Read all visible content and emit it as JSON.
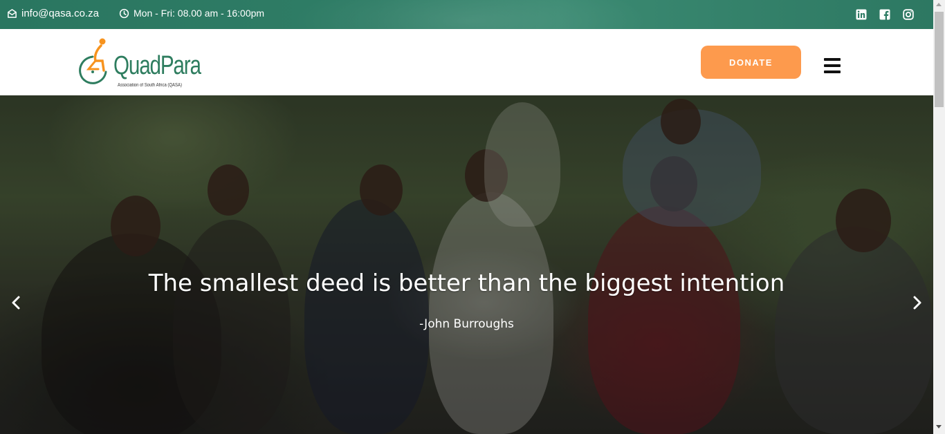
{
  "topbar": {
    "email": "info@qasa.co.za",
    "hours": "Mon - Fri: 08.00 am - 16:00pm",
    "icons": [
      "envelope-icon",
      "clock-icon",
      "linkedin-icon",
      "facebook-icon",
      "instagram-icon"
    ],
    "background": "#2f7d66"
  },
  "header": {
    "logo": {
      "wordmark": "QuadPara",
      "tagline": "Association of South Africa (QASA)"
    },
    "donate_label": "DONATE",
    "menu_icon": "hamburger-menu-icon",
    "accent": "#fd9a4d",
    "brand_green": "#2e7d5f"
  },
  "hero": {
    "quote": "The smallest deed is better than the biggest intention",
    "author": "-John Burroughs",
    "prev_icon": "chevron-left-icon",
    "next_icon": "chevron-right-icon"
  }
}
